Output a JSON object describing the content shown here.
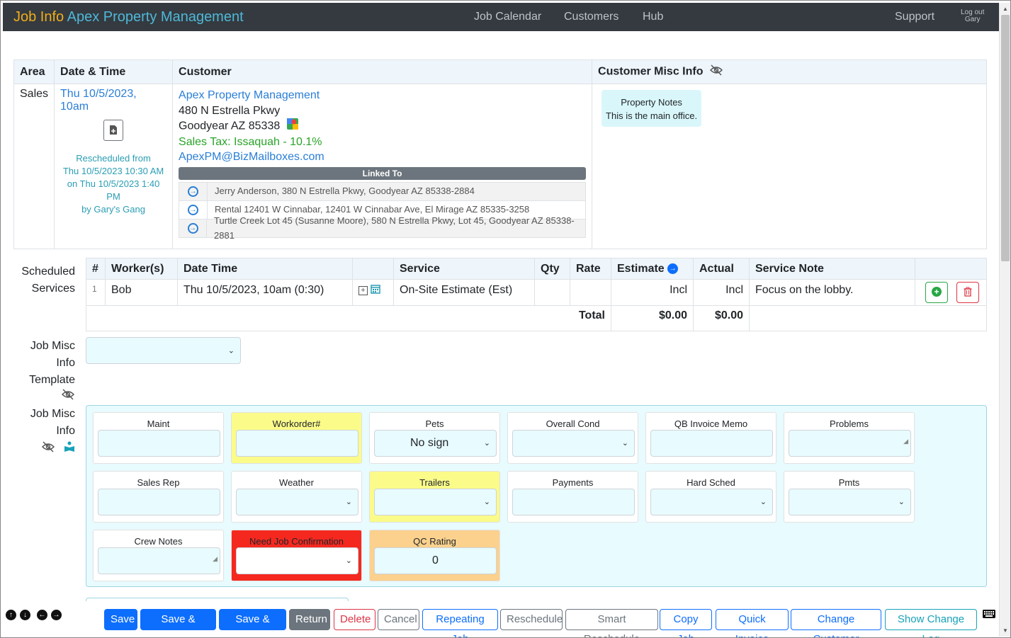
{
  "header": {
    "title": "Job Info",
    "company": "Apex Property Management",
    "nav": [
      "Job Calendar",
      "Customers",
      "Hub"
    ],
    "support": "Support",
    "logout": "Log out",
    "user": "Gary"
  },
  "info_table": {
    "headers": {
      "area": "Area",
      "datetime": "Date & Time",
      "customer": "Customer",
      "misc": "Customer Misc Info"
    },
    "area": "Sales",
    "datetime": "Thu 10/5/2023, 10am",
    "rescheduled": [
      "Rescheduled from",
      "Thu 10/5/2023 10:30 AM",
      "on Thu 10/5/2023 1:40 PM",
      "by Gary's Gang"
    ],
    "customer": {
      "name": "Apex Property Management",
      "address1": "480 N Estrella Pkwy",
      "address2": "Goodyear AZ 85338",
      "tax": "Sales Tax: Issaquah - 10.1%",
      "email": "ApexPM@BizMailboxes.com"
    },
    "linked_to_label": "Linked To",
    "linked": [
      "Jerry Anderson, 380 N Estrella Pkwy, Goodyear AZ 85338-2884",
      "Rental 12401 W Cinnabar, 12401 W Cinnabar Ave, El Mirage AZ 85335-3258",
      "Turtle Creek Lot 45 (Susanne Moore), 580 N Estrella Pkwy, Lot 45, Goodyear AZ 85338-2881"
    ],
    "property_notes_title": "Property Notes",
    "property_notes": "This is the main office."
  },
  "services": {
    "label": [
      "Scheduled",
      "Services"
    ],
    "headers": {
      "num": "#",
      "workers": "Worker(s)",
      "datetime": "Date Time",
      "service": "Service",
      "qty": "Qty",
      "rate": "Rate",
      "estimate": "Estimate",
      "actual": "Actual",
      "note": "Service Note"
    },
    "row": {
      "num": "1",
      "workers": "Bob",
      "datetime": "Thu 10/5/2023, 10am (0:30)",
      "service": "On-Site Estimate (Est)",
      "qty": "",
      "rate": "",
      "estimate": "Incl",
      "actual": "Incl",
      "note": "Focus on the lobby."
    },
    "total_label": "Total",
    "total_estimate": "$0.00",
    "total_actual": "$0.00"
  },
  "template_label": [
    "Job Misc",
    "Info",
    "Template"
  ],
  "misc_label": [
    "Job Misc",
    "Info"
  ],
  "misc_fields": [
    {
      "label": "Maint",
      "value": ""
    },
    {
      "label": "Workorder#",
      "value": ""
    },
    {
      "label": "Pets",
      "value": "No sign"
    },
    {
      "label": "Overall Cond",
      "value": ""
    },
    {
      "label": "QB Invoice Memo",
      "value": ""
    },
    {
      "label": "Problems",
      "value": ""
    },
    {
      "label": "Sales Rep",
      "value": ""
    },
    {
      "label": "Weather",
      "value": ""
    },
    {
      "label": "Trailers",
      "value": ""
    },
    {
      "label": "Payments",
      "value": ""
    },
    {
      "label": "Hard Sched",
      "value": ""
    },
    {
      "label": "Pmts",
      "value": ""
    },
    {
      "label": "Crew Notes",
      "value": ""
    },
    {
      "label": "Need Job Confirmation",
      "value": ""
    },
    {
      "label": "QC Rating",
      "value": "0"
    }
  ],
  "footer": {
    "buttons": [
      "Save",
      "Save & Return",
      "Save & Next",
      "Return",
      "Delete",
      "Cancel",
      "Repeating Job",
      "Reschedule",
      "Smart Reschedule",
      "Copy Job",
      "Quick Invoice",
      "Change Customer",
      "Show Change Log"
    ]
  },
  "colors": {
    "topbar": "#343a40",
    "title": "#f0ad1c",
    "company": "#4fb8d8",
    "link": "#2a7ed6",
    "misc_bg": "#e8fbfe",
    "yellow": "#fbfb8a",
    "red": "#f5281f",
    "orange": "#fbd18d"
  }
}
